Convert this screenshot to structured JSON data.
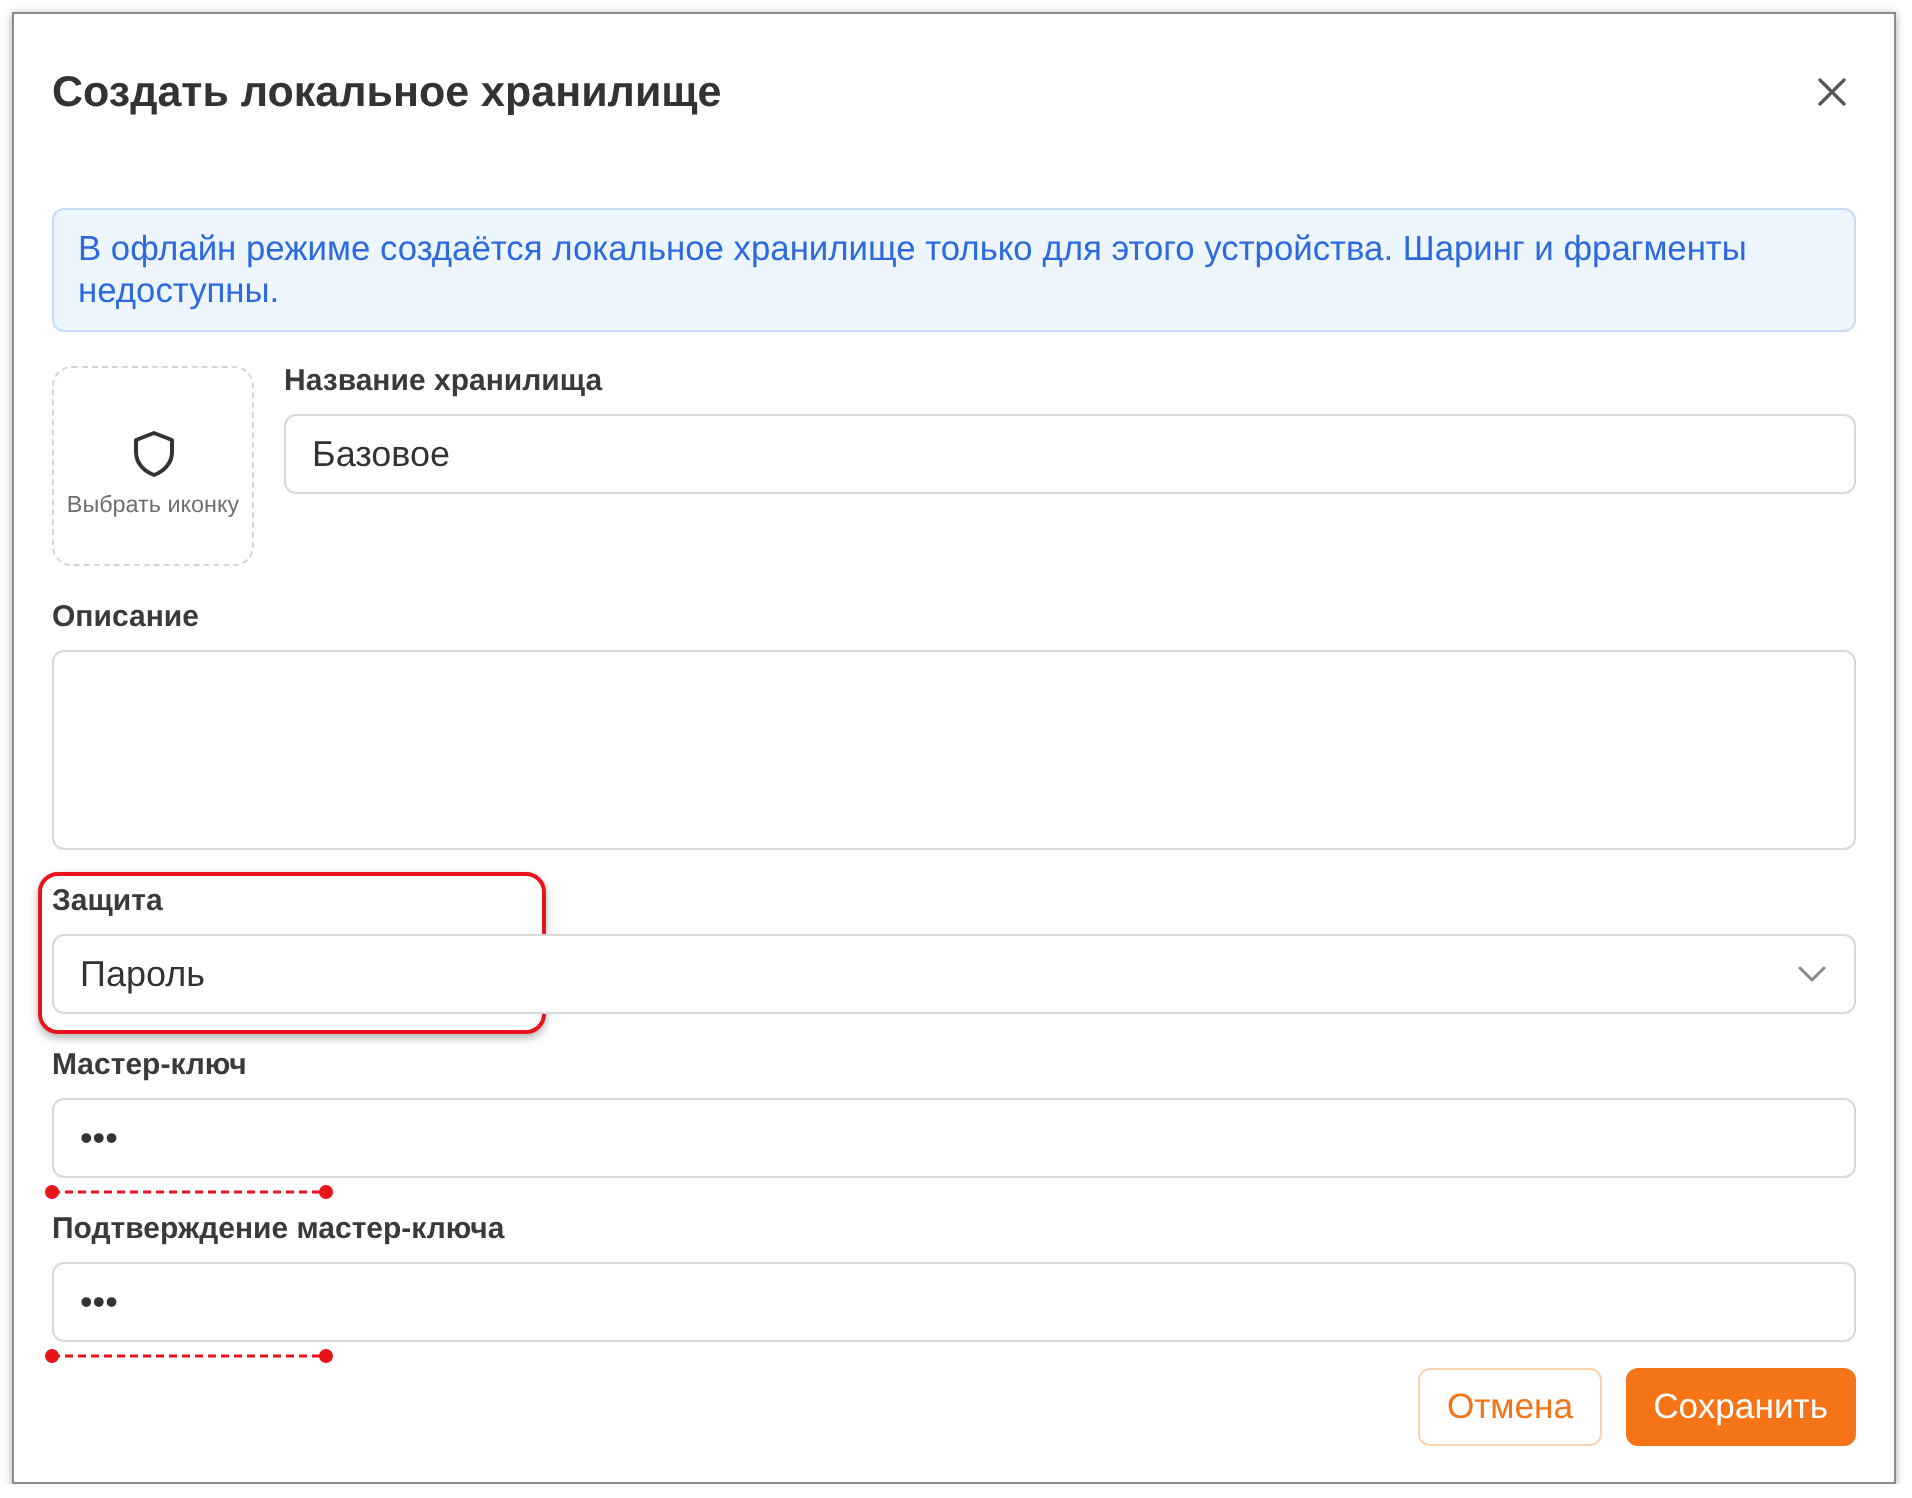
{
  "dialog": {
    "title": "Создать локальное хранилище"
  },
  "notice": "В офлайн режиме создаётся локальное хранилище только для этого устройства. Шаринг и фрагменты недоступны.",
  "icon_picker": {
    "label": "Выбрать иконку"
  },
  "fields": [
    {
      "kind": "text",
      "label": "Название хранилища",
      "value": "Базовое"
    },
    {
      "kind": "textarea",
      "label": "Описание"
    },
    {
      "kind": "select",
      "label": "Защита",
      "value": "Пароль",
      "highlighted": true
    },
    {
      "kind": "password",
      "label": "Мастер-ключ",
      "value": "•••",
      "underlined": true
    },
    {
      "kind": "password",
      "label": "Подтверждение мастер-ключа",
      "value": "•••",
      "underlined": true
    }
  ],
  "buttons": [
    {
      "kind": "secondary",
      "label": "Отмена"
    },
    {
      "kind": "primary",
      "label": "Сохранить"
    }
  ]
}
